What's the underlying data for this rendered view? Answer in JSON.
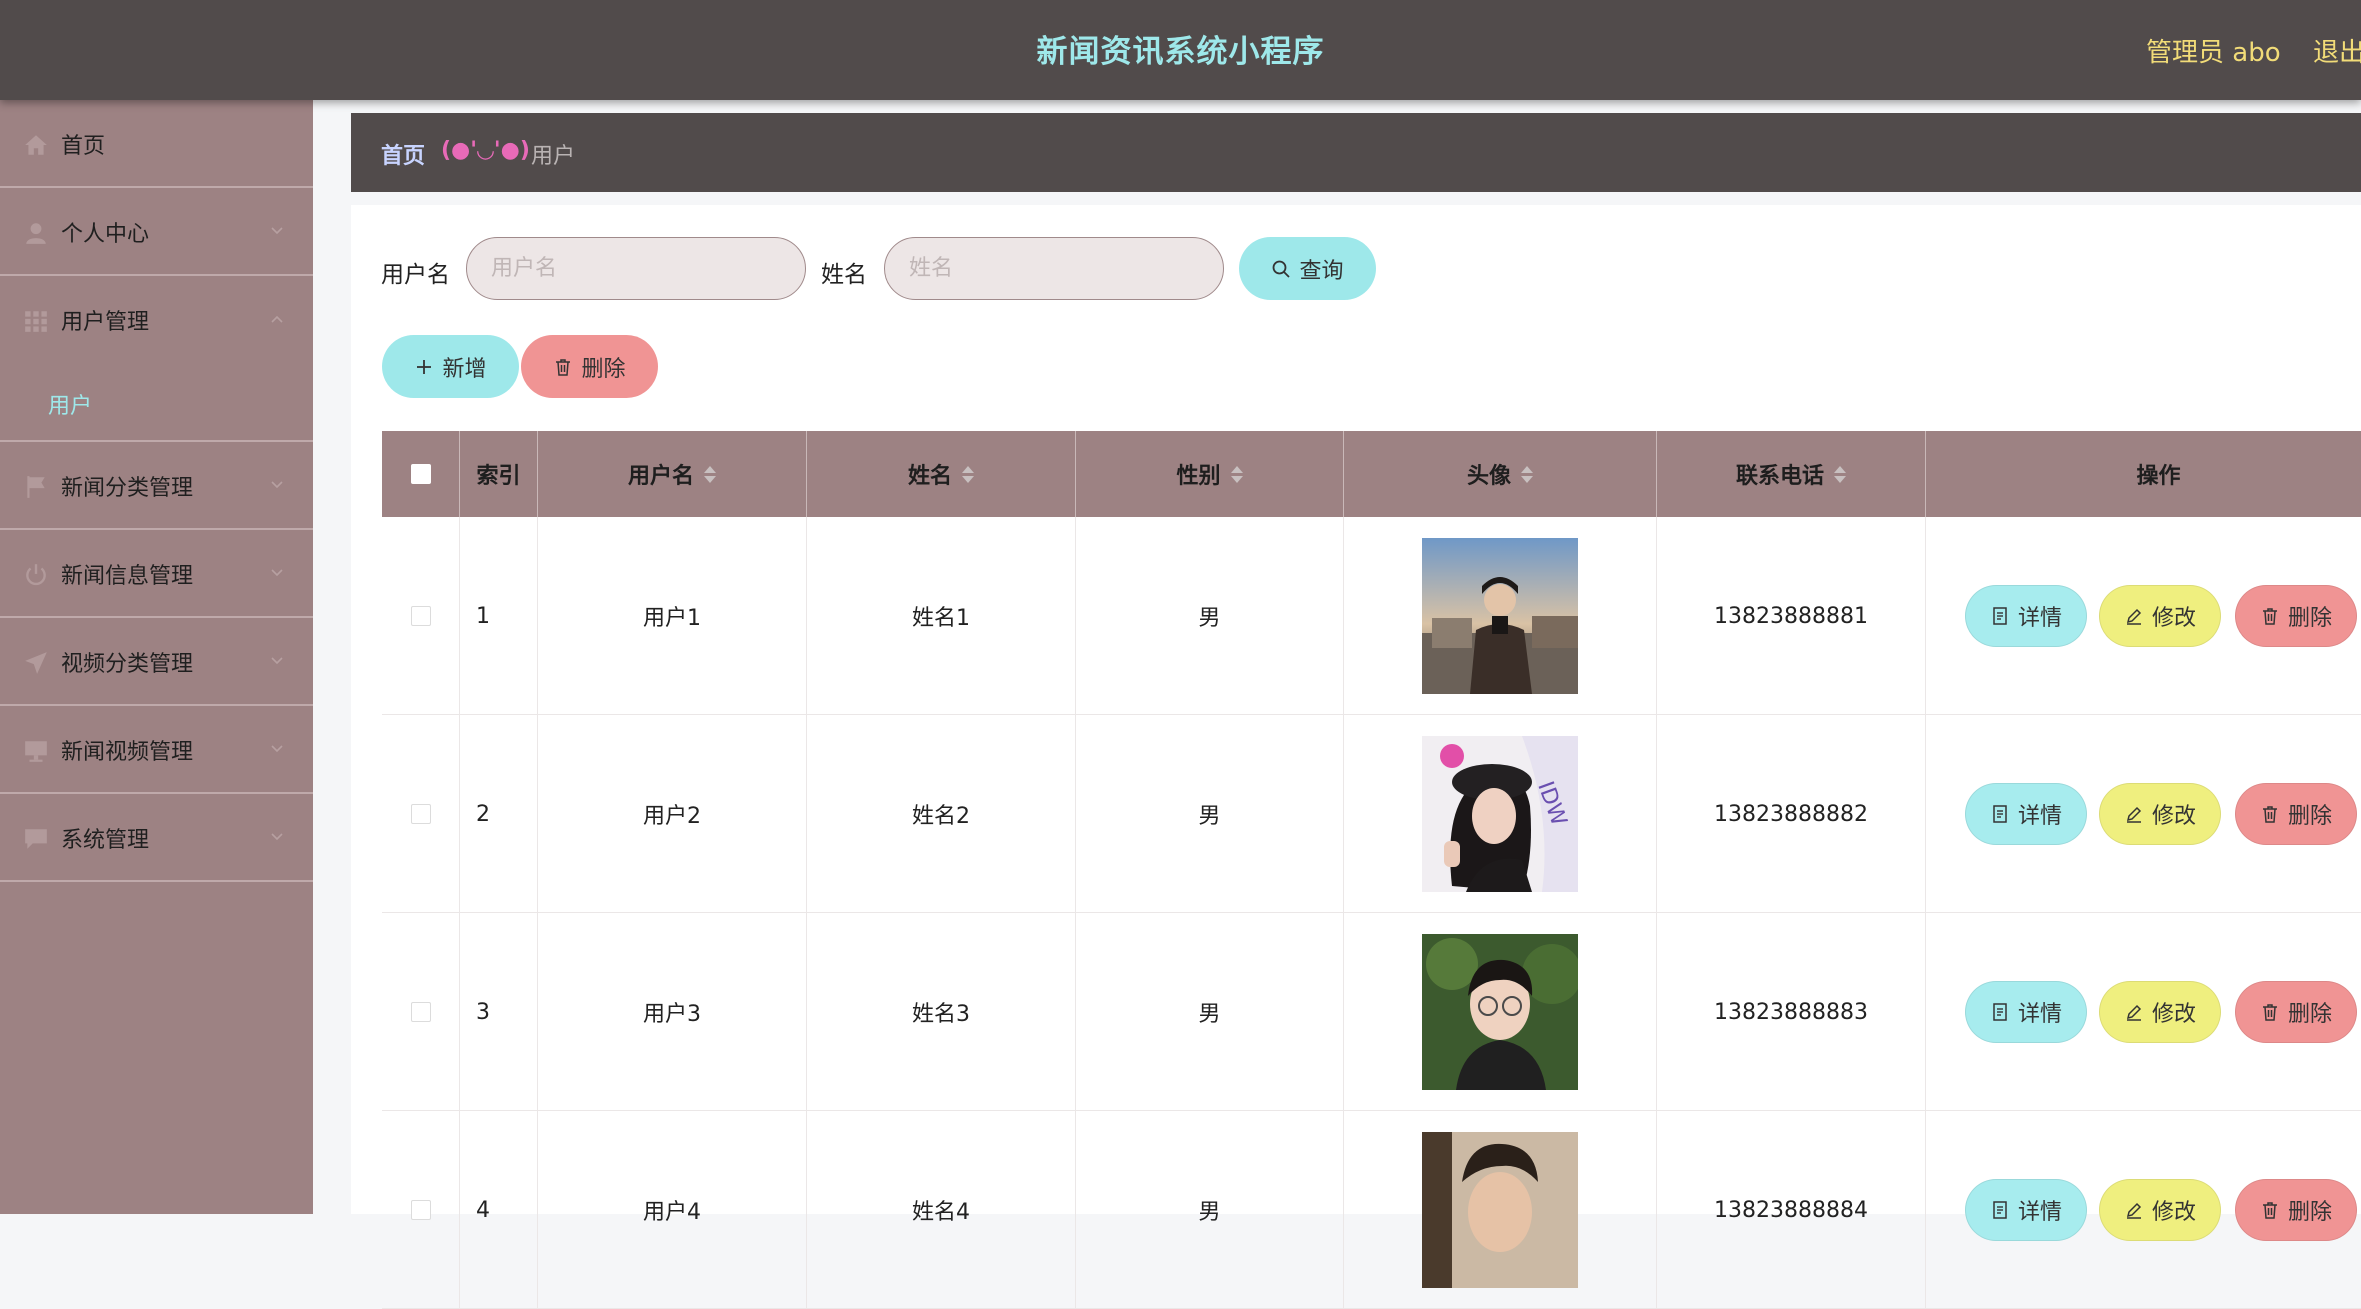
{
  "header": {
    "title": "新闻资讯系统小程序",
    "admin_label": "管理员 abo",
    "logout_label": "退出"
  },
  "sidebar": {
    "items": [
      {
        "label": "首页",
        "icon": "home-icon"
      },
      {
        "label": "个人中心",
        "icon": "user-icon"
      },
      {
        "label": "用户管理",
        "icon": "grid-icon",
        "expanded": true,
        "sub": "用户"
      },
      {
        "label": "新闻分类管理",
        "icon": "flag-icon"
      },
      {
        "label": "新闻信息管理",
        "icon": "power-icon"
      },
      {
        "label": "视频分类管理",
        "icon": "send-icon"
      },
      {
        "label": "新闻视频管理",
        "icon": "monitor-icon"
      },
      {
        "label": "系统管理",
        "icon": "chat-icon"
      }
    ]
  },
  "breadcrumb": {
    "home": "首页",
    "separator": "(●'◡'●)",
    "current": "用户"
  },
  "search": {
    "username_label": "用户名",
    "username_placeholder": "用户名",
    "name_label": "姓名",
    "name_placeholder": "姓名",
    "query_label": "查询"
  },
  "toolbar": {
    "add_label": "新增",
    "delete_label": "删除"
  },
  "table": {
    "headers": {
      "index": "索引",
      "username": "用户名",
      "name": "姓名",
      "gender": "性别",
      "avatar": "头像",
      "phone": "联系电话",
      "actions": "操作"
    },
    "rows": [
      {
        "index": "1",
        "username": "用户1",
        "name": "姓名1",
        "gender": "男",
        "phone": "13823888881"
      },
      {
        "index": "2",
        "username": "用户2",
        "name": "姓名2",
        "gender": "男",
        "phone": "13823888882"
      },
      {
        "index": "3",
        "username": "用户3",
        "name": "姓名3",
        "gender": "男",
        "phone": "13823888883"
      },
      {
        "index": "4",
        "username": "用户4",
        "name": "姓名4",
        "gender": "男",
        "phone": "13823888884"
      }
    ],
    "actions": {
      "detail": "详情",
      "edit": "修改",
      "delete": "删除"
    }
  },
  "colors": {
    "topbar": "#514b4b",
    "sidebar": "#9d8283",
    "accent_cyan": "#9ee8ea",
    "edit_yellow": "#efef7f",
    "delete_red": "#f09494"
  }
}
